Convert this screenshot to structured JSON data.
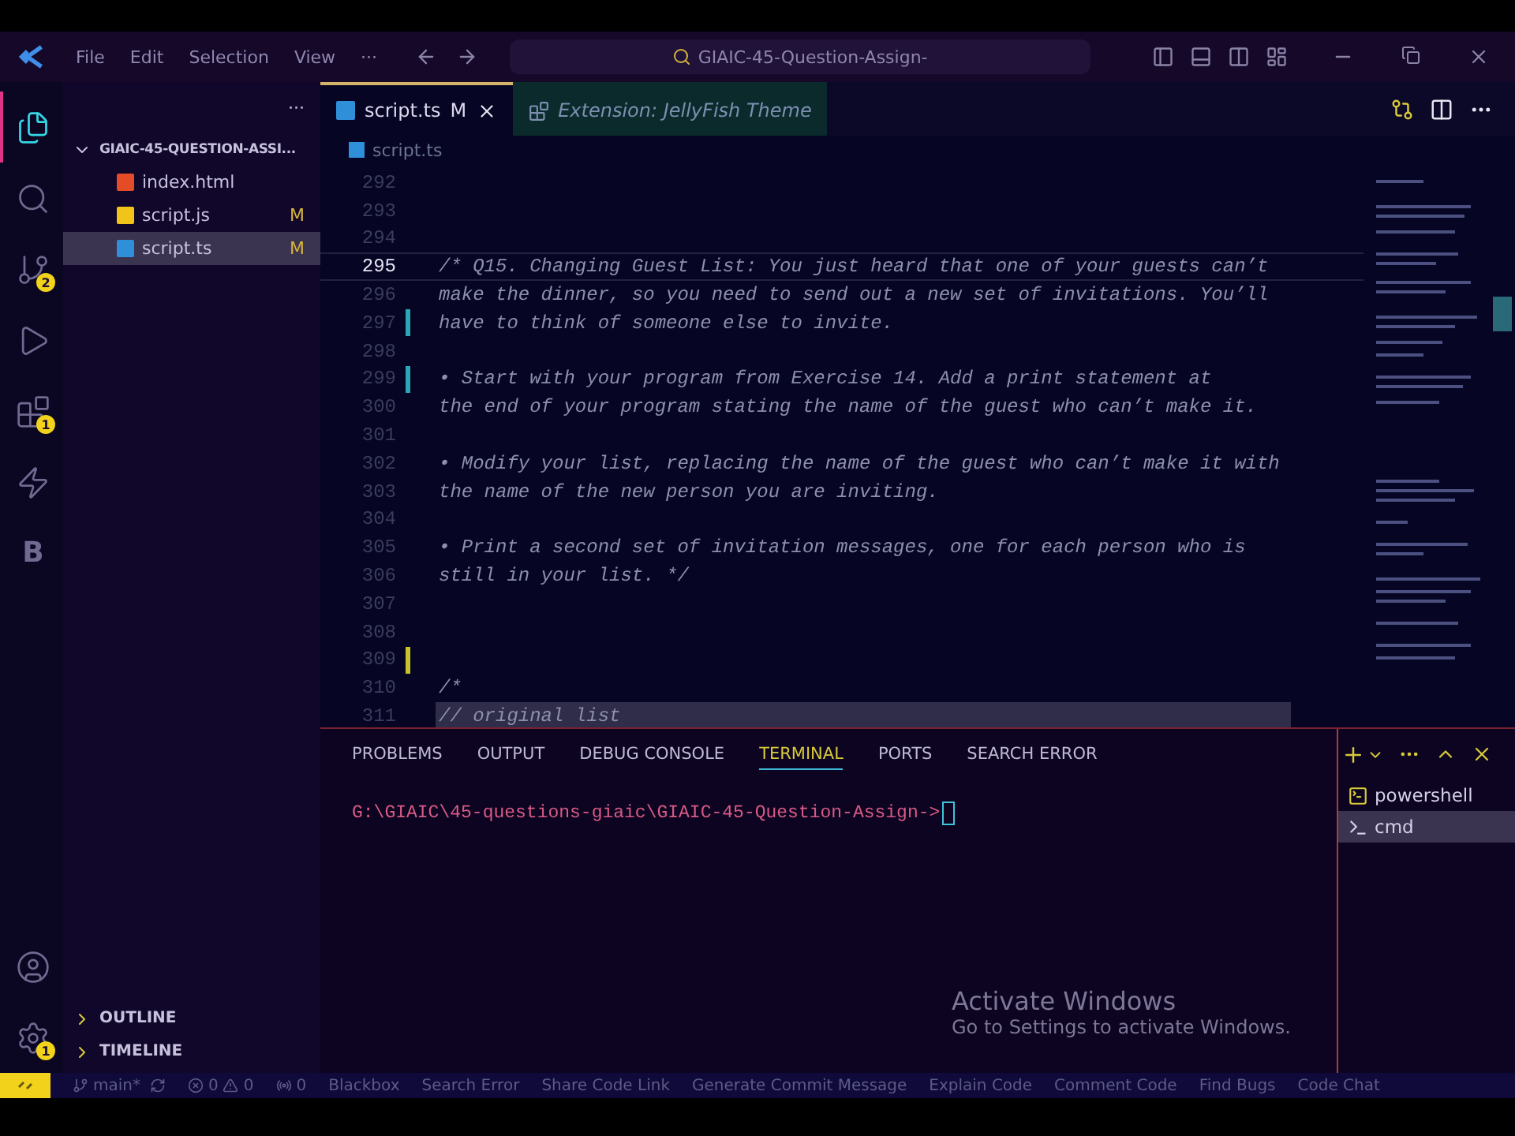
{
  "menu": [
    "File",
    "Edit",
    "Selection",
    "View",
    "···"
  ],
  "command_center": "GIAIC-45-Question-Assign-",
  "activity_bar": [
    {
      "kind": "explorer",
      "selected": true
    },
    {
      "kind": "search",
      "selected": false
    },
    {
      "kind": "source-control",
      "selected": false,
      "badge": "2"
    },
    {
      "kind": "run",
      "selected": false
    },
    {
      "kind": "extensions",
      "selected": false,
      "badge": "1"
    },
    {
      "kind": "bolt",
      "selected": false
    },
    {
      "kind": "letter",
      "selected": false,
      "text": "B"
    }
  ],
  "activity_bottom": [
    {
      "kind": "account"
    },
    {
      "kind": "settings",
      "badge": "1"
    }
  ],
  "explorer": {
    "more": "···",
    "folder": "GIAIC-45-QUESTION-ASSI...",
    "expanded": true,
    "files": [
      {
        "name": "index.html",
        "kind": "html",
        "selected": false
      },
      {
        "name": "script.js",
        "kind": "js",
        "status": "M",
        "selected": false
      },
      {
        "name": "script.ts",
        "kind": "ts",
        "status": "M",
        "selected": true
      }
    ],
    "sections": [
      {
        "label": "OUTLINE",
        "expanded": false
      },
      {
        "label": "TIMELINE",
        "expanded": false
      }
    ]
  },
  "tabs": [
    {
      "label": "script.ts",
      "kind": "file",
      "status": "M",
      "selected": true
    },
    {
      "label": "Extension: JellyFish Theme",
      "kind": "extension",
      "selected": false
    }
  ],
  "breadcrumb": "script.ts",
  "code": [
    {
      "number": "292"
    },
    {
      "number": "293"
    },
    {
      "number": "294"
    },
    {
      "number": "295",
      "text": "/* Q15. Changing Guest List: You just heard that one of your guests can’t",
      "current": true
    },
    {
      "number": "296",
      "text": "make the dinner, so you need to send out a new set of invitations. You’ll"
    },
    {
      "number": "297",
      "text": "have to think of someone else to invite.",
      "modified": true
    },
    {
      "number": "298"
    },
    {
      "number": "299",
      "text": "• Start with your program from Exercise 14. Add a print statement at",
      "modified": true
    },
    {
      "number": "300",
      "text": "the end of your program stating the name of the guest who can’t make it."
    },
    {
      "number": "301"
    },
    {
      "number": "302",
      "text": "• Modify your list, replacing the name of the guest who can’t make it with"
    },
    {
      "number": "303",
      "text": "the name of the new person you are inviting."
    },
    {
      "number": "304"
    },
    {
      "number": "305",
      "text": "• Print a second set of invitation messages, one for each person who is"
    },
    {
      "number": "306",
      "text": "still in your list. */"
    },
    {
      "number": "307"
    },
    {
      "number": "308"
    },
    {
      "number": "309",
      "added": true
    },
    {
      "number": "310",
      "text": "/*"
    },
    {
      "number": "311",
      "text": "// original list",
      "highlighted": true
    }
  ],
  "panel_tabs": [
    {
      "label": "PROBLEMS",
      "selected": false
    },
    {
      "label": "OUTPUT",
      "selected": false
    },
    {
      "label": "DEBUG CONSOLE",
      "selected": false
    },
    {
      "label": "TERMINAL",
      "selected": true
    },
    {
      "label": "PORTS",
      "selected": false
    },
    {
      "label": "SEARCH ERROR",
      "selected": false
    }
  ],
  "terminal": {
    "prompt": "G:\\GIAIC\\45-questions-giaic\\GIAIC-45-Question-Assign->"
  },
  "terminals": [
    {
      "label": "powershell",
      "kind": "powershell",
      "selected": false
    },
    {
      "label": "cmd",
      "kind": "cmd",
      "selected": true
    }
  ],
  "activation": {
    "title": "Activate Windows",
    "message": "Go to Settings to activate Windows."
  },
  "status_bar": {
    "branch": "main*",
    "errors": "0",
    "warnings": "0",
    "ports": "0",
    "items": [
      "Blackbox",
      "Search Error",
      "Share Code Link",
      "Generate Commit Message",
      "Explain Code",
      "Comment Code",
      "Find Bugs",
      "Code Chat"
    ]
  }
}
